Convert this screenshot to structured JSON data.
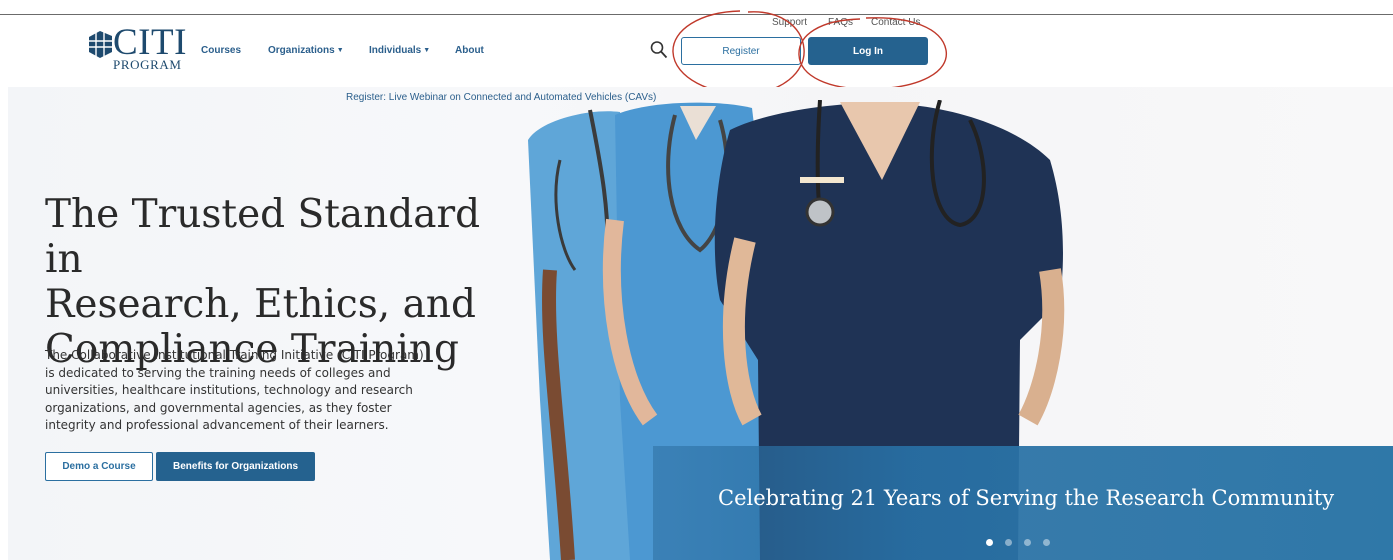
{
  "header": {
    "logo_text": "CITI",
    "logo_subtext": "PROGRAM",
    "nav": [
      {
        "label": "Courses",
        "dropdown": false
      },
      {
        "label": "Organizations",
        "dropdown": true
      },
      {
        "label": "Individuals",
        "dropdown": true
      },
      {
        "label": "About",
        "dropdown": false
      }
    ],
    "utility_links": [
      "Support",
      "FAQs",
      "Contact Us"
    ],
    "search_icon": "search-icon",
    "register_label": "Register",
    "login_label": "Log In"
  },
  "banner": {
    "text": "Register: Live Webinar on Connected and Automated Vehicles (CAVs)"
  },
  "hero": {
    "title_lines": [
      "The Trusted Standard in",
      "Research, Ethics, and",
      "Compliance Training"
    ],
    "description_lines": [
      "The Collaborative Institutional Training Initiative (CITI Program)",
      "is dedicated to serving the training needs of colleges and",
      "universities, healthcare institutions, technology and research",
      "organizations, and governmental agencies, as they foster",
      "integrity and professional advancement of their learners."
    ],
    "demo_button": "Demo a Course",
    "benefits_button": "Benefits for Organizations",
    "slide_caption": "Celebrating 21 Years of Serving the Research Community",
    "carousel": {
      "total": 4,
      "active_index": 0
    }
  },
  "colors": {
    "brand": "#25628f",
    "link": "#2b5f8c",
    "annotation": "#c0392b",
    "caption_band": "#2f78a8"
  }
}
